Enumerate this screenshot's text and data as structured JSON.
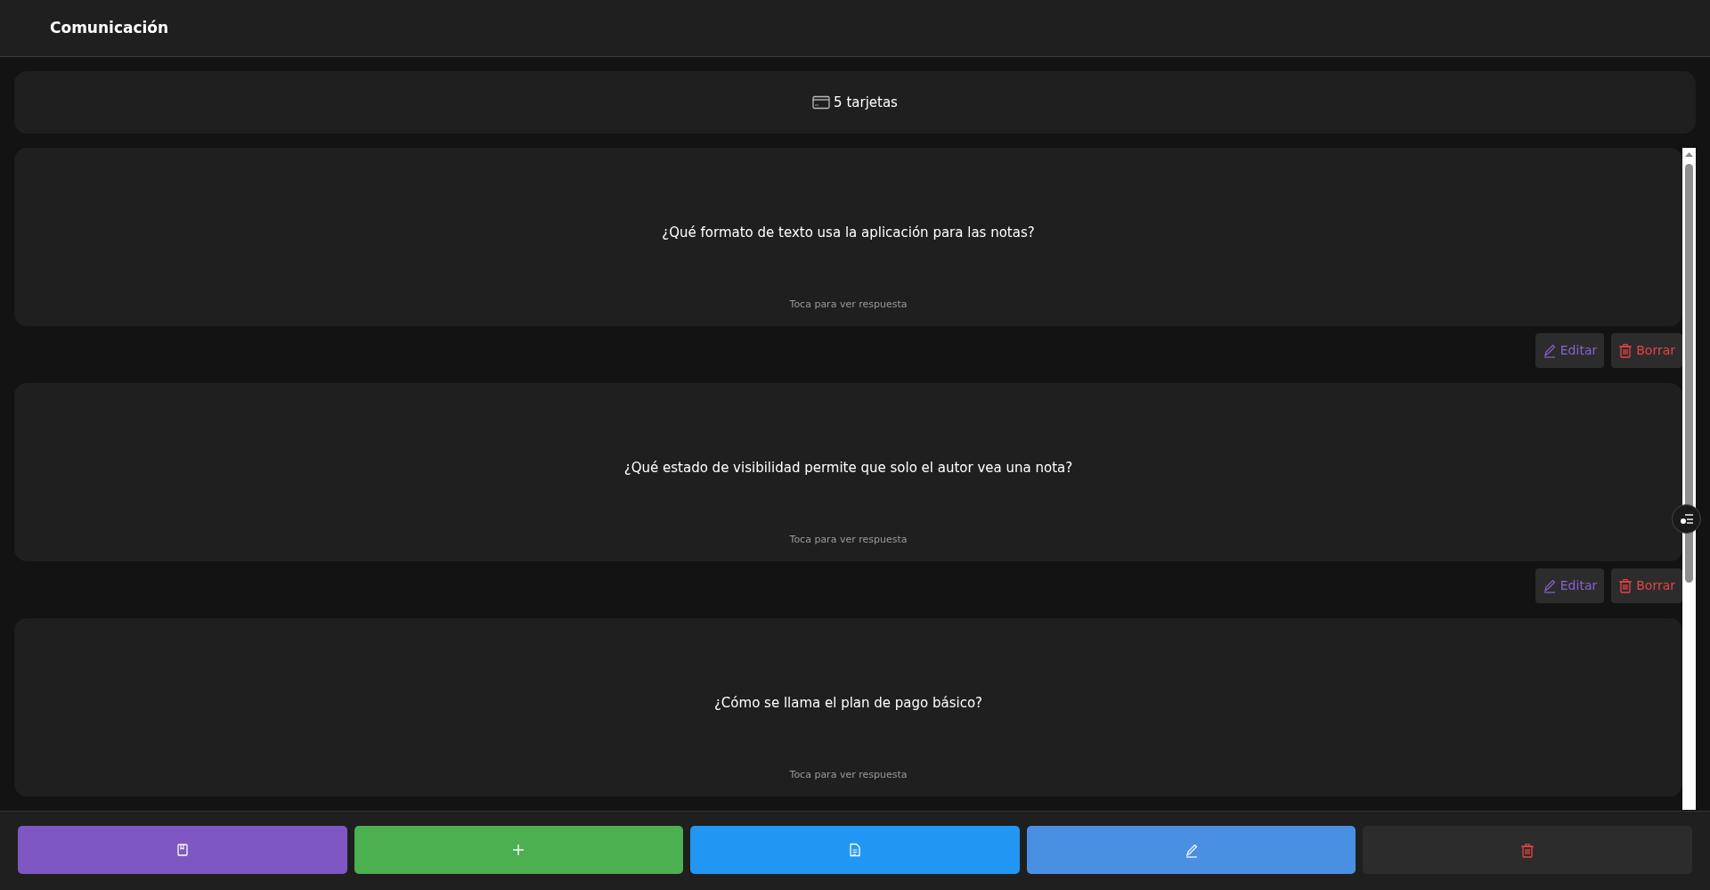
{
  "header": {
    "title": "Comunicación"
  },
  "summary": {
    "count_text": "5 tarjetas"
  },
  "cards": [
    {
      "question": "¿Qué formato de texto usa la aplicación para las notas?",
      "hint": "Toca para ver respuesta",
      "actions": [
        "Editar",
        "Borrar"
      ]
    },
    {
      "question": "¿Qué estado de visibilidad permite que solo el autor vea una nota?",
      "hint": "Toca para ver respuesta",
      "actions": [
        "Editar",
        "Borrar"
      ]
    },
    {
      "question": "¿Cómo se llama el plan de pago básico?",
      "hint": "Toca para ver respuesta"
    }
  ],
  "toolbar": [
    {
      "kind": "book",
      "color": "#7e57c2"
    },
    {
      "kind": "add",
      "color": "#4caf50"
    },
    {
      "kind": "document",
      "color": "#2196f3"
    },
    {
      "kind": "edit",
      "color": "#4a90e2"
    },
    {
      "kind": "delete",
      "color": "#2c2c2c"
    }
  ]
}
